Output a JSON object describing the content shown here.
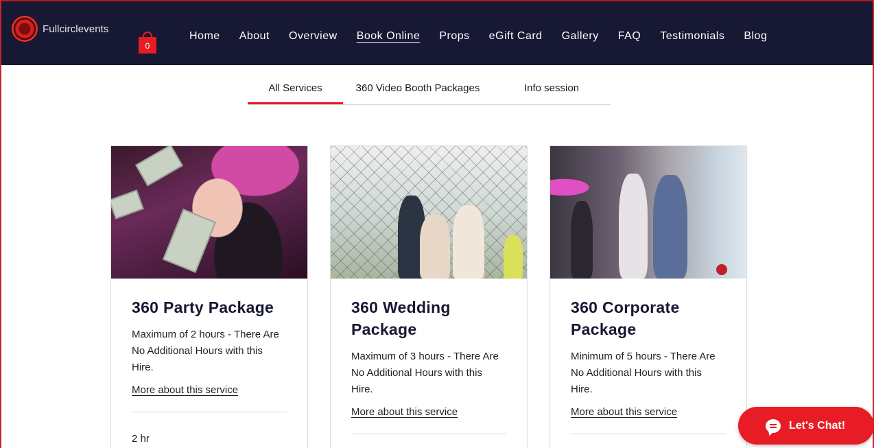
{
  "site": {
    "name": "Fullcirclevents"
  },
  "cart": {
    "count": "0"
  },
  "nav": {
    "items": [
      "Home",
      "About",
      "Overview",
      "Book Online",
      "Props",
      "eGift Card",
      "Gallery",
      "FAQ",
      "Testimonials",
      "Blog"
    ],
    "active": "Book Online"
  },
  "tabs": {
    "items": [
      "All Services",
      "360 Video Booth Packages",
      "Info session"
    ],
    "active": "All Services"
  },
  "services": [
    {
      "title": "360 Party Package",
      "description": "Maximum of 2 hours - There Are No Additional Hours with this Hire.",
      "link": "More about this service",
      "duration": "2 hr"
    },
    {
      "title": "360 Wedding Package",
      "description": "Maximum of 3 hours - There Are No Additional Hours with this Hire.",
      "link": "More about this service"
    },
    {
      "title": "360 Corporate Package",
      "description": "Minimum of 5 hours - There Are No Additional Hours with this Hire.",
      "link": "More about this service"
    }
  ],
  "chat": {
    "label": "Let's Chat!"
  },
  "colors": {
    "brand_dark": "#171833",
    "accent_red": "#e81c24"
  }
}
